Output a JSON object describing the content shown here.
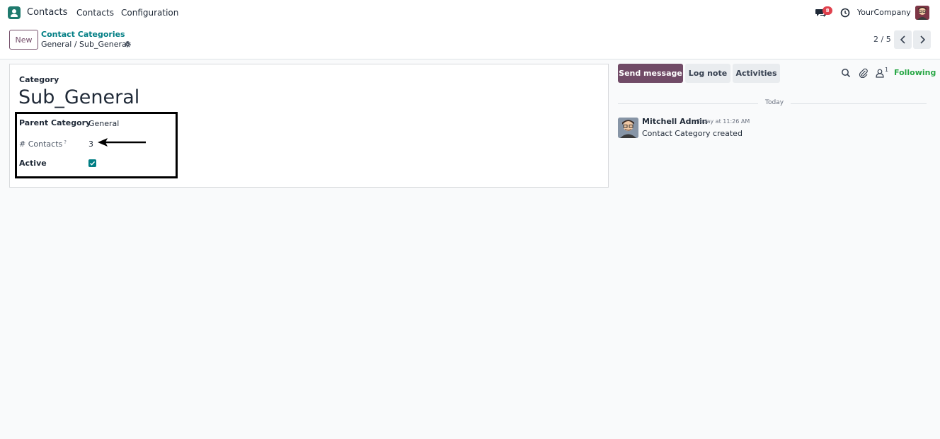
{
  "navbar": {
    "app_name": "Contacts",
    "menu": [
      "Contacts",
      "Configuration"
    ],
    "messages_badge": "8",
    "company": "YourCompany"
  },
  "control": {
    "new_label": "New",
    "breadcrumb_parent": "Contact Categories",
    "breadcrumb_current": "General / Sub_General",
    "pager": "2 / 5"
  },
  "form": {
    "category_label": "Category",
    "title": "Sub_General",
    "fields": {
      "parent_label": "Parent Category",
      "parent_value": "General",
      "contacts_label": "# Contacts",
      "contacts_help": "?",
      "contacts_value": "3",
      "active_label": "Active",
      "active_checked": true
    }
  },
  "chatter": {
    "send_message": "Send message",
    "log_note": "Log note",
    "activities": "Activities",
    "followers_count": "1",
    "following": "Following",
    "date_separator": "Today",
    "message": {
      "author": "Mitchell Admin",
      "time": "Today at 11:26 AM",
      "body": "Contact Category created"
    }
  },
  "colors": {
    "brand": "#714b67",
    "link": "#017e84",
    "following": "#28a745"
  }
}
